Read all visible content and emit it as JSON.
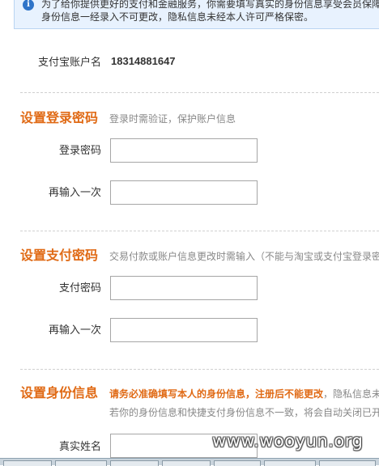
{
  "notice": {
    "icon": "info-icon",
    "line1": "为了给你提供更好的支付和金融服务，你需要填写真实的身份信息享受会员保障",
    "line2": "身份信息一经录入不可更改，隐私信息未经本人许可严格保密。"
  },
  "account": {
    "label": "支付宝账户名",
    "value": "18314881647"
  },
  "login_password": {
    "title": "设置登录密码",
    "hint": "登录时需验证，保护账户信息",
    "field1_label": "登录密码",
    "field2_label": "再输入一次"
  },
  "pay_password": {
    "title": "设置支付密码",
    "hint": "交易付款或账户信息更改时需输入（不能与淘宝或支付宝登录密",
    "field1_label": "支付密码",
    "field2_label": "再输入一次"
  },
  "identity": {
    "title": "设置身份信息",
    "hint_warn": "请务必准确填写本人的身份信息，注册后不能更改",
    "hint_rest": "，隐私信息未",
    "hint_line2": "若你的身份信息和快捷支付身份信息不一致，将会自动关闭已开",
    "name_label": "真实姓名"
  },
  "watermark": "www.wooyun.org",
  "colors": {
    "section_title": "#e06a15",
    "notice_bg": "#e8f2fe",
    "notice_border": "#b9d4f2",
    "hint": "#888888"
  }
}
